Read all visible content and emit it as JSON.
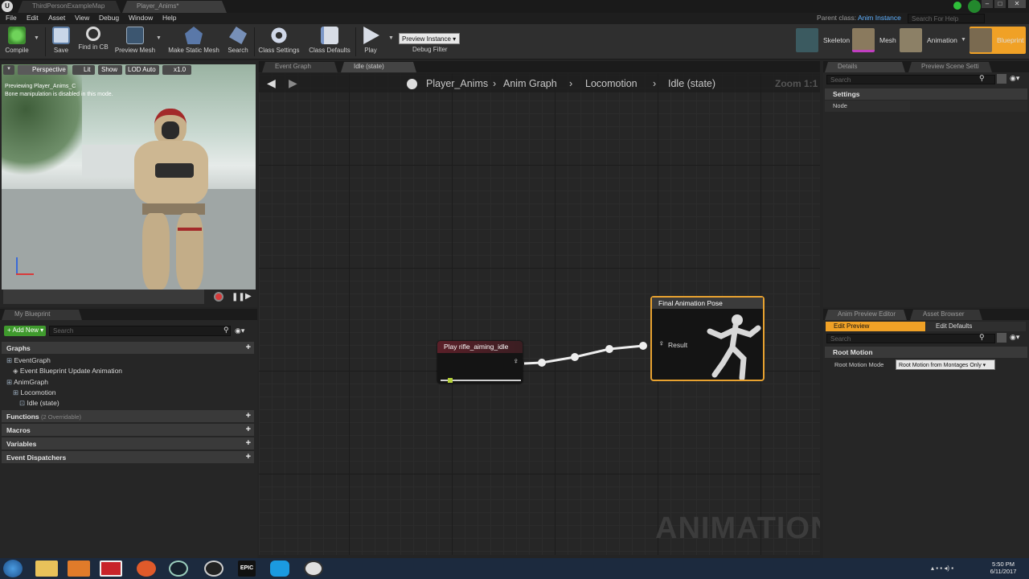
{
  "window": {
    "tabs": [
      "ThirdPersonExampleMap",
      "Player_Anims*"
    ],
    "minimize": "–",
    "maximize": "□",
    "close": "✕"
  },
  "menu": {
    "items": [
      "File",
      "Edit",
      "Asset",
      "View",
      "Debug",
      "Window",
      "Help"
    ],
    "parent_class_label": "Parent class:",
    "parent_class_value": "Anim Instance",
    "search_placeholder": "Search For Help"
  },
  "toolbar": {
    "buttons": [
      "Compile",
      "Save",
      "Find in CB",
      "Preview Mesh",
      "Make Static Mesh",
      "Search",
      "Class Settings",
      "Class Defaults",
      "Play"
    ],
    "debug_select": "Preview Instance",
    "debug_filter_label": "Debug Filter",
    "modes": [
      "Skeleton",
      "Mesh",
      "Animation",
      "Blueprint"
    ]
  },
  "viewport": {
    "buttons": [
      "Perspective",
      "Lit",
      "Show",
      "LOD Auto",
      "x1.0"
    ],
    "overlay_line1": "Previewing Player_Anims_C",
    "overlay_line2": "Bone manipulation is disabled in this mode."
  },
  "my_blueprint": {
    "tab": "My Blueprint",
    "add_new": "Add New",
    "search_placeholder": "Search",
    "sections": {
      "graphs": "Graphs",
      "functions": "Functions",
      "functions_note": "(2 Overridable)",
      "macros": "Macros",
      "variables": "Variables",
      "dispatchers": "Event Dispatchers"
    },
    "tree": [
      "EventGraph",
      "Event Blueprint Update Animation",
      "AnimGraph",
      "Locomotion",
      "Idle (state)"
    ]
  },
  "graph": {
    "tabs": [
      "Event Graph",
      "Idle (state)"
    ],
    "breadcrumb": [
      "Player_Anims",
      "Anim Graph",
      "Locomotion",
      "Idle (state)"
    ],
    "zoom": "Zoom 1:1",
    "watermark": "ANIMATION",
    "play_node_title": "Play rifle_aiming_idle",
    "result_node_title": "Final Animation Pose",
    "result_pin": "Result"
  },
  "details": {
    "tabs": [
      "Details",
      "Preview Scene Setti"
    ],
    "search_placeholder": "Search",
    "section": "Settings",
    "node_label": "Node"
  },
  "anim_preview": {
    "tabs": [
      "Anim Preview Editor",
      "Asset Browser"
    ],
    "edit_preview": "Edit Preview",
    "edit_defaults": "Edit Defaults",
    "search_placeholder": "Search",
    "section": "Root Motion",
    "root_motion_label": "Root Motion Mode",
    "root_motion_value": "Root Motion from Montages Only"
  },
  "taskbar": {
    "time": "5:50 PM",
    "date": "6/11/2017",
    "epic_label": "EPIC"
  },
  "colors": {
    "accent_orange": "#f0a126",
    "result_node_border": "#e8a230",
    "add_new_green": "#3f9a2d"
  }
}
